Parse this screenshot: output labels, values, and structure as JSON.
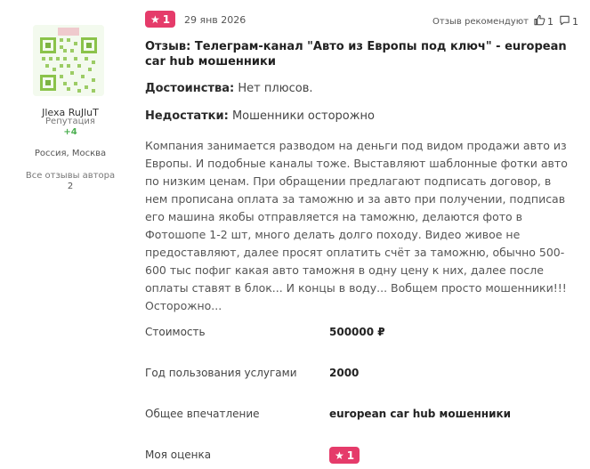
{
  "author": {
    "name": "Jlexa RuJluT",
    "reputation_label": "Репутация",
    "reputation_value": "+4",
    "location": "Россия, Москва",
    "all_reviews_label": "Все отзывы автора",
    "all_reviews_count": "2"
  },
  "review": {
    "rating": "1",
    "date": "29 янв 2026",
    "recommend_label": "Отзыв рекомендуют",
    "likes": "1",
    "comments": "1",
    "title": "Отзыв: Телеграм-канал \"Авто из Европы под ключ\" - european car hub мошенники",
    "pros_label": "Достоинства:",
    "pros_text": "Нет плюсов.",
    "cons_label": "Недостатки:",
    "cons_text": "Мошенники осторожно",
    "body": "Компания занимается разводом на деньги под видом продажи авто из Европы. И подобные каналы тоже. Выставляют шаблонные фотки авто по низким ценам. При обращении предлагают подписать договор, в нем прописана оплата за таможню и за авто при получении, подписав его машина якобы отправляется на таможню, делаются фото в Фотошопе 1-2 шт, много делать долго походу. Видео живое не предоставляют, далее просят оплатить счёт за таможню, обычно 500-600 тыс пофиг какая авто таможня в одну цену к них, далее после оплаты ставят в блок... И концы в воду... Вобщем просто мошенники!!! Осторожно..."
  },
  "properties": {
    "cost_label": "Стоимость",
    "cost_value": "500000 ₽",
    "year_label": "Год пользования услугами",
    "year_value": "2000",
    "impression_label": "Общее впечатление",
    "impression_value": "european car hub мошенники",
    "rating_label": "Моя оценка",
    "rating_value": "1"
  },
  "icons": {
    "star": "star-icon",
    "like": "thumbs-up-icon",
    "comment": "comment-icon"
  },
  "colors": {
    "badge": "#e53b6a",
    "reputation": "#4caf50"
  }
}
